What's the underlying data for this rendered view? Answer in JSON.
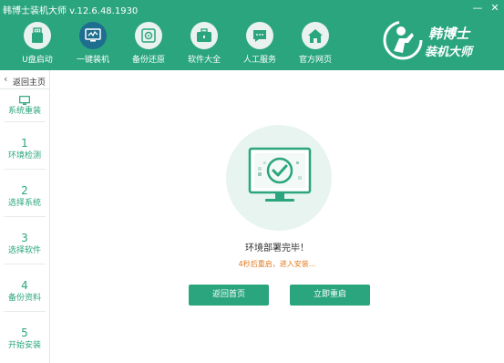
{
  "window": {
    "title": "韩博士装机大师 v.12.6.48.1930",
    "minimize_label": "—",
    "close_label": "✕"
  },
  "nav": {
    "items": [
      {
        "label": "U盘启动",
        "icon": "usb-drive-icon"
      },
      {
        "label": "一键装机",
        "icon": "monitor-icon",
        "active": true
      },
      {
        "label": "备份还原",
        "icon": "backup-icon"
      },
      {
        "label": "软件大全",
        "icon": "briefcase-icon"
      },
      {
        "label": "人工服务",
        "icon": "chat-icon"
      },
      {
        "label": "官方网页",
        "icon": "home-icon"
      }
    ]
  },
  "brand": {
    "line1": "韩博士",
    "line2": "装机大师"
  },
  "sidebar": {
    "back_label": "返回主页",
    "steps": [
      {
        "number": "",
        "label": "系统重装",
        "icon": "monitor-icon"
      },
      {
        "number": "1",
        "label": "环境检测"
      },
      {
        "number": "2",
        "label": "选择系统"
      },
      {
        "number": "3",
        "label": "选择软件"
      },
      {
        "number": "4",
        "label": "备份资料"
      },
      {
        "number": "5",
        "label": "开始安装"
      }
    ]
  },
  "main": {
    "status_title": "环境部署完毕！",
    "countdown_text": "4秒后重启，进入安装...",
    "buttons": {
      "back_home": "返回首页",
      "restart_now": "立即重启"
    },
    "illustration_icon": "monitor-check-icon"
  },
  "colors": {
    "brand_green": "#2aa57e",
    "active_nav": "#1d6e8f",
    "countdown_orange": "#e07b1f"
  }
}
